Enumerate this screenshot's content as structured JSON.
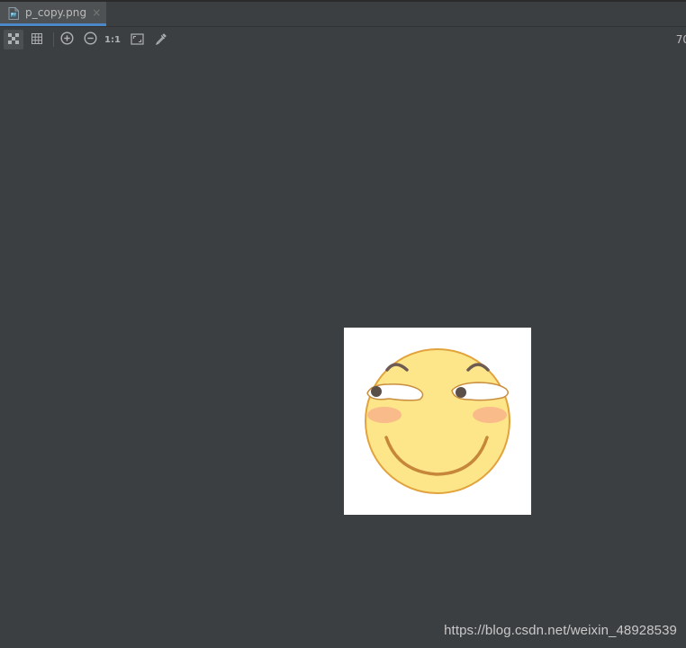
{
  "tab": {
    "filename": "p_copy.png",
    "close_glyph": "×",
    "file_icon": "image-file-icon"
  },
  "toolbar": {
    "buttons": [
      {
        "name": "chessboard-toggle",
        "icon": "chessboard-icon",
        "active": true
      },
      {
        "name": "grid-toggle",
        "icon": "grid-icon",
        "active": false
      },
      {
        "name": "zoom-in",
        "icon": "zoom-in-icon",
        "active": false
      },
      {
        "name": "zoom-out",
        "icon": "zoom-out-icon",
        "active": false
      },
      {
        "name": "actual-size",
        "icon": "actual-size-icon",
        "label": "1:1",
        "active": false
      },
      {
        "name": "fit-zoom",
        "icon": "fit-zoom-icon",
        "active": false
      },
      {
        "name": "color-picker",
        "icon": "eyedropper-icon",
        "active": false
      }
    ],
    "one_to_one_label": "1:1",
    "zoom_readout": "70"
  },
  "canvas": {
    "image_content": "smiling-emoji",
    "image_background": "#ffffff"
  },
  "watermark": {
    "text": "https://blog.csdn.net/weixin_48928539"
  },
  "colors": {
    "accent_tab_underline": "#4a88c7",
    "editor_background": "#3c3f41",
    "face_fill": "#fde68a",
    "face_outline": "#e2a23c",
    "cheek": "#f9b38a",
    "mouth": "#c6873a"
  }
}
